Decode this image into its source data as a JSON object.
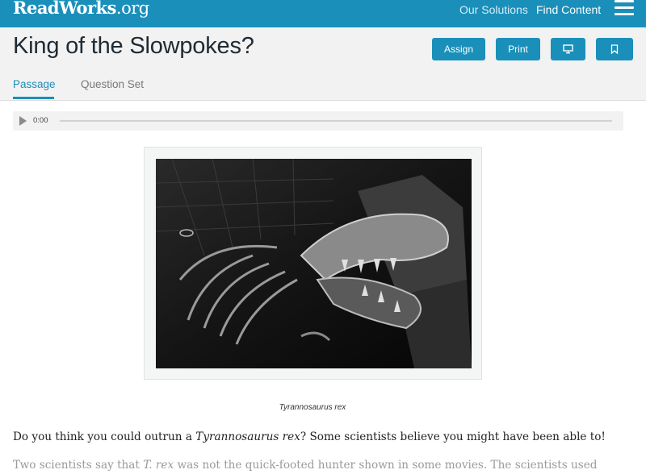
{
  "header": {
    "logo_text": "ReadWorks",
    "logo_suffix": ".org",
    "nav": {
      "our_solutions": "Our Solutions",
      "find_content": "Find Content"
    },
    "menu_icon": "hamburger-icon"
  },
  "article": {
    "title": "King of the Slowpokes?",
    "actions": {
      "assign": "Assign",
      "print": "Print",
      "present_icon": "monitor-icon",
      "bookmark_icon": "bookmark-icon"
    },
    "tabs": [
      {
        "label": "Passage",
        "active": true
      },
      {
        "label": "Question Set",
        "active": false
      }
    ]
  },
  "audio": {
    "time": "0:00",
    "play_icon": "play-icon",
    "progress": 0
  },
  "figure": {
    "caption": "Tyrannosaurus rex"
  },
  "body": {
    "p1_start": "Do you think you could outrun a ",
    "p1_italic": "Tyrannosaurus rex",
    "p1_end": "? Some scientists believe you might have been able to!",
    "p2_start": "Two scientists say that ",
    "p2_italic": "T. rex",
    "p2_end": " was not the quick-footed hunter shown in some movies. The scientists used"
  },
  "colors": {
    "brand": "#1a8fba",
    "subheader_bg": "#f2f2f2"
  }
}
